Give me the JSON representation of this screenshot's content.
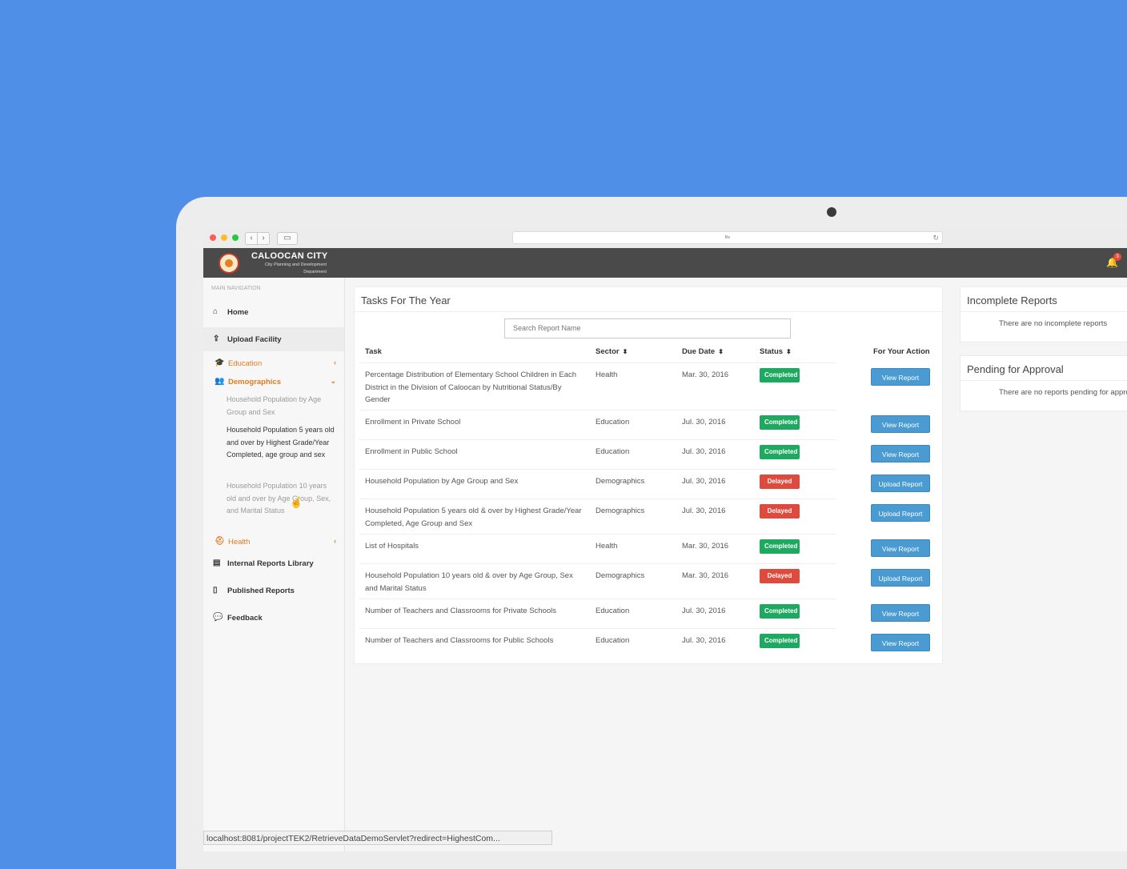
{
  "browser": {
    "url_text": "file"
  },
  "header": {
    "title": "CALOOCAN CITY",
    "subtitle": "City Planning and Development Department",
    "notification_count": "3"
  },
  "sidebar": {
    "heading": "MAIN NAVIGATION",
    "home": "Home",
    "upload": "Upload Facility",
    "education": "Education",
    "demographics": "Demographics",
    "demo_items": [
      "Household Population by Age Group and Sex",
      "Household Population 5 years old and over by Highest Grade/Year Completed, age group and sex",
      "Household Population 10 years old and over by Age Group, Sex, and Marital Status"
    ],
    "health": "Health",
    "internal": "Internal Reports Library",
    "published": "Published Reports",
    "feedback": "Feedback"
  },
  "tasks": {
    "title": "Tasks For The Year",
    "search_placeholder": "Search Report Name",
    "columns": {
      "task": "Task",
      "sector": "Sector",
      "due": "Due Date",
      "status": "Status",
      "action": "For Your Action"
    },
    "rows": [
      {
        "task": "Percentage Distribution of Elementary School Children in Each District in the Division of Caloocan by Nutritional Status/By Gender",
        "sector": "Health",
        "due": "Mar. 30, 2016",
        "status": "Completed",
        "action": "View Report"
      },
      {
        "task": "Enrollment in Private School",
        "sector": "Education",
        "due": "Jul. 30, 2016",
        "status": "Completed",
        "action": "View Report"
      },
      {
        "task": "Enrollment in Public School",
        "sector": "Education",
        "due": "Jul. 30, 2016",
        "status": "Completed",
        "action": "View Report"
      },
      {
        "task": "Household Population by Age Group and Sex",
        "sector": "Demographics",
        "due": "Jul. 30, 2016",
        "status": "Delayed",
        "action": "Upload Report"
      },
      {
        "task": "Household Population 5 years old & over by Highest Grade/Year Completed, Age Group and Sex",
        "sector": "Demographics",
        "due": "Jul. 30, 2016",
        "status": "Delayed",
        "action": "Upload Report"
      },
      {
        "task": "List of Hospitals",
        "sector": "Health",
        "due": "Mar. 30, 2016",
        "status": "Completed",
        "action": "View Report"
      },
      {
        "task": "Household Population 10 years old & over by Age Group, Sex and Marital Status",
        "sector": "Demographics",
        "due": "Mar. 30, 2016",
        "status": "Delayed",
        "action": "Upload Report"
      },
      {
        "task": "Number of Teachers and Classrooms for Private Schools",
        "sector": "Education",
        "due": "Jul. 30, 2016",
        "status": "Completed",
        "action": "View Report"
      },
      {
        "task": "Number of Teachers and Classrooms for Public Schools",
        "sector": "Education",
        "due": "Jul. 30, 2016",
        "status": "Completed",
        "action": "View Report"
      }
    ]
  },
  "incomplete": {
    "title": "Incomplete Reports",
    "message": "There are no incomplete reports"
  },
  "pending": {
    "title": "Pending for Approval",
    "message": "There are no reports pending for approval"
  },
  "statusbar": {
    "text": "localhost:8081/projectTEK2/RetrieveDataDemoServlet?redirect=HighestCom..."
  },
  "colors": {
    "background": "#4f8fe8",
    "completed": "#1daa60",
    "delayed": "#e04a3c",
    "button": "#4a9bd2",
    "accent": "#e07b20"
  }
}
